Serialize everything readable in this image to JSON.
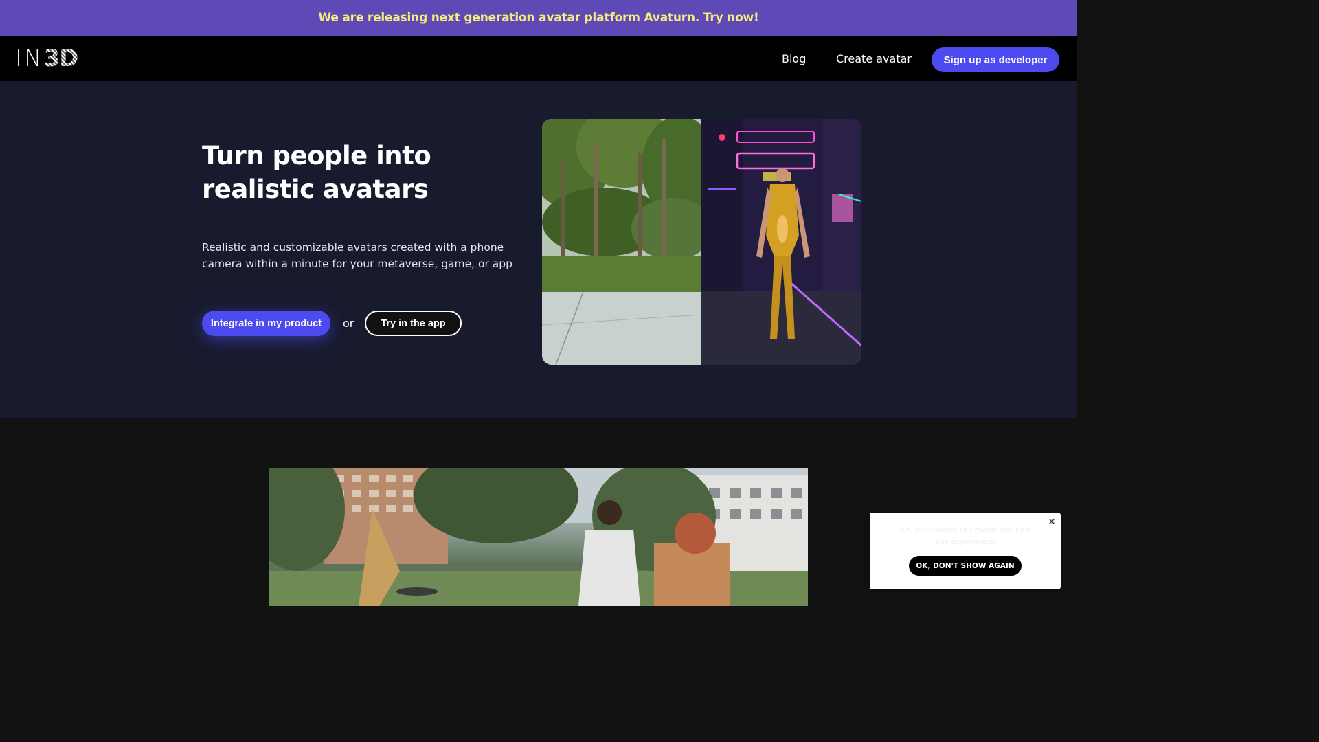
{
  "banner": {
    "text": "We are releasing next generation avatar platform Avaturn. Try now!"
  },
  "nav": {
    "logo": {
      "part1": "IN",
      "part2": "3D"
    },
    "links": [
      "Blog",
      "Create avatar"
    ],
    "signup_label": "Sign up as developer"
  },
  "hero": {
    "title": "Turn people into realistic avatars",
    "subtitle": "Realistic and customizable avatars created with a phone camera within a minute for your metaverse, game, or app",
    "integrate_label": "Integrate in my product",
    "or_text": "or",
    "try_label": "Try in the app"
  },
  "cookie": {
    "text": "We use cookies to provide the best site experience.",
    "ok_label": "OK, DON'T SHOW AGAIN",
    "close_icon": "close-icon"
  },
  "colors": {
    "banner_bg": "#5e49b6",
    "banner_text": "#f3ec7a",
    "accent": "#4d4aef",
    "hero_bg": "#181a2e",
    "nav_bg": "#000000"
  }
}
